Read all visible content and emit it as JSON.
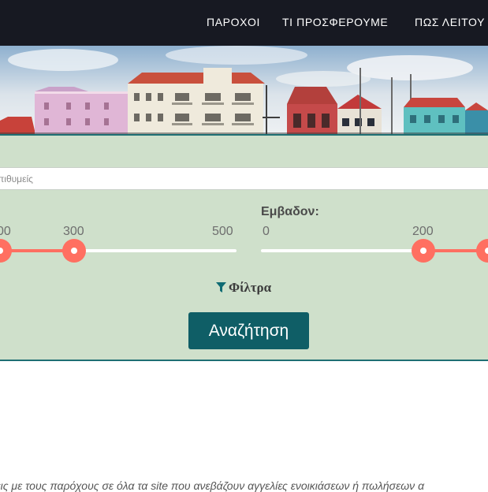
{
  "nav": {
    "items": [
      {
        "label": "ΠΑΡΟΧΟΙ"
      },
      {
        "label": "ΤΙ ΠΡΟΣΦΕΡΟΥΜΕ"
      },
      {
        "label": "ΠΩΣ ΛΕΙΤΟΥ"
      }
    ]
  },
  "search": {
    "keyword_placeholder": "πιθυμείς"
  },
  "price_slider": {
    "ticks": [
      "00",
      "300",
      "500"
    ]
  },
  "area_slider": {
    "label": "Εμβαδον:",
    "ticks": [
      "0",
      "200"
    ]
  },
  "filters": {
    "label": "Φίλτρα",
    "icon": "funnel-icon"
  },
  "search_button": {
    "label": "Αναζήτηση"
  },
  "intro_text": "σεις με τους παρόχους σε όλα τα site που ανεβάζουν αγγελίες ενοικιάσεων ή πωλήσεων α",
  "colors": {
    "nav_bg": "#171922",
    "search_bg": "#cfe0cb",
    "accent_border": "#1e6f73",
    "slider_handle": "#ff6f61",
    "button_bg": "#0f5e66"
  }
}
